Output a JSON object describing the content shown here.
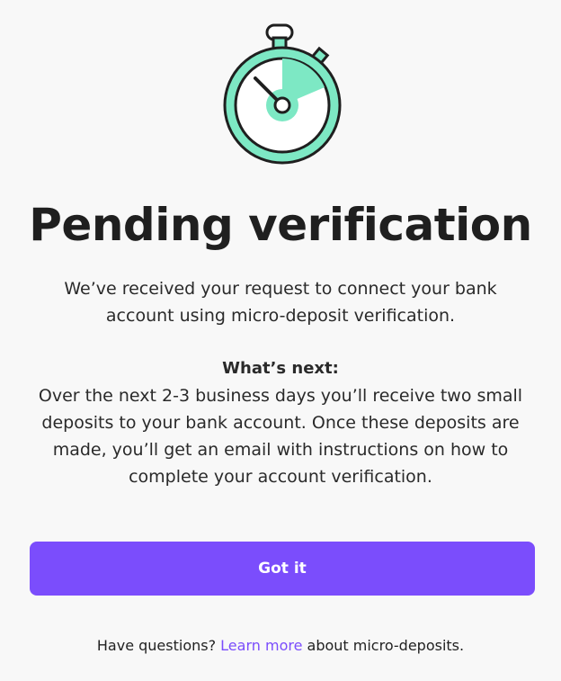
{
  "icon": {
    "name": "stopwatch-icon",
    "accent_color": "#7de8c4",
    "outline_color": "#1f1f1f"
  },
  "title": "Pending verification",
  "intro": "We’ve received your request to connect your bank account using micro-deposit verification.",
  "whats_next": {
    "heading": "What’s next:",
    "body": "Over the next 2-3 business days you’ll receive two small deposits to your bank account. Once these deposits are made, you’ll get an email with instructions on how to complete your account verification."
  },
  "button": {
    "label": "Got it",
    "color": "#7b4dfc"
  },
  "footer": {
    "prefix": "Have questions? ",
    "link_label": "Learn more",
    "suffix": " about micro-deposits."
  }
}
